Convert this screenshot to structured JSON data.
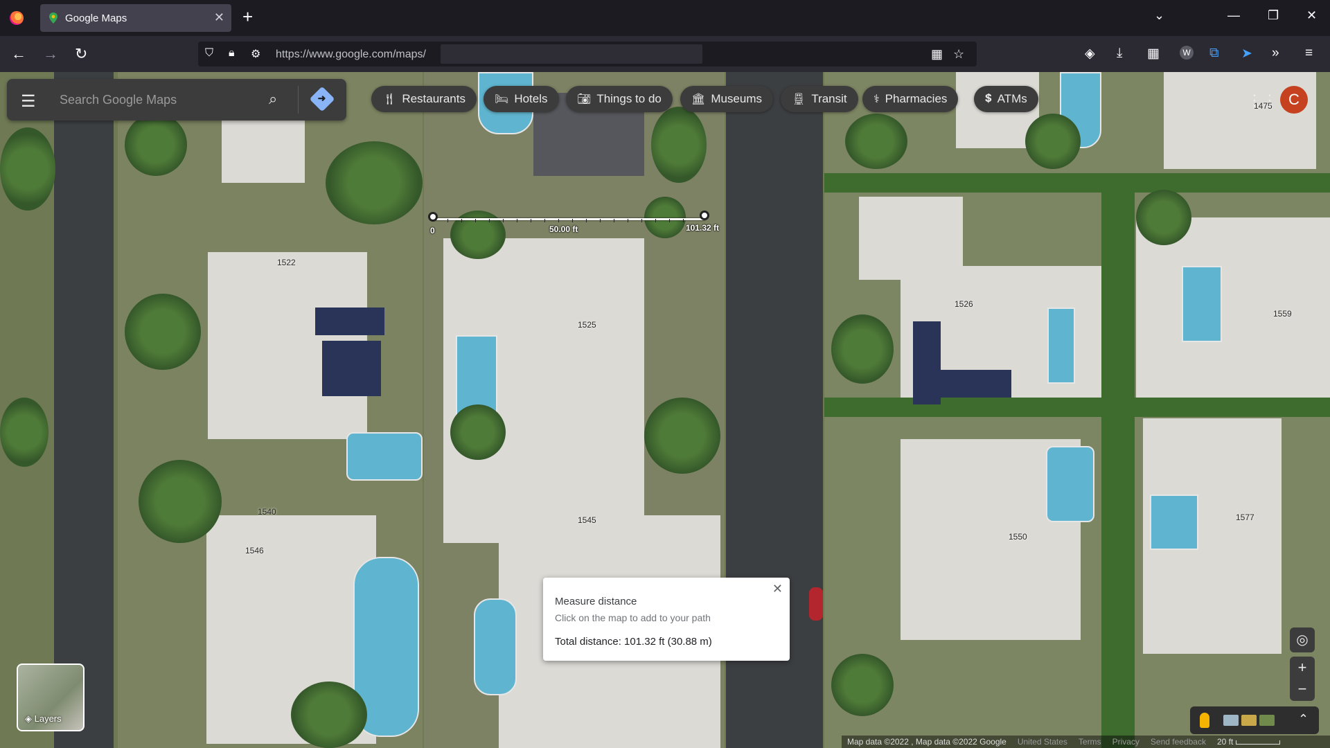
{
  "browser": {
    "tab_title": "Google Maps",
    "url": "https://www.google.com/maps/",
    "icons": [
      "firefox-icon",
      "shield-icon",
      "lock-icon",
      "permissions-icon",
      "qr-icon",
      "star-icon",
      "pocket-icon",
      "download-icon",
      "extensions-icon",
      "account-icon",
      "sync-icon",
      "cursor-icon",
      "overflow-icon",
      "menu-icon"
    ],
    "account_initial": "W"
  },
  "search": {
    "placeholder": "Search Google Maps"
  },
  "chips": [
    {
      "label": "Restaurants",
      "icon": "fork-knife-icon"
    },
    {
      "label": "Hotels",
      "icon": "bed-icon"
    },
    {
      "label": "Things to do",
      "icon": "camera-icon"
    },
    {
      "label": "Museums",
      "icon": "museum-icon"
    },
    {
      "label": "Transit",
      "icon": "transit-icon"
    },
    {
      "label": "Pharmacies",
      "icon": "pharmacy-icon"
    },
    {
      "label": "ATMs",
      "icon": "atm-icon"
    }
  ],
  "user": {
    "avatar_initial": "C",
    "avatar_color": "#c5411f"
  },
  "measure": {
    "start_label": "0",
    "mid_label": "50.00 ft",
    "end_label": "101.32 ft",
    "card_title": "Measure distance",
    "card_hint": "Click on the map to add to your path",
    "card_total": "Total distance: 101.32 ft (30.88 m)"
  },
  "map_labels": {
    "n1475": "1475",
    "n1522": "1522",
    "n1525": "1525",
    "n1526": "1526",
    "n1559": "1559",
    "n1540": "1540",
    "n1545": "1545",
    "n1546": "1546",
    "n1550": "1550",
    "n1577": "1577"
  },
  "layers": {
    "label": "Layers"
  },
  "footer": {
    "map_data": "Map data ©2022 , Map data ©2022 Google",
    "country": "United States",
    "terms": "Terms",
    "privacy": "Privacy",
    "feedback": "Send feedback",
    "scale": "20 ft"
  }
}
